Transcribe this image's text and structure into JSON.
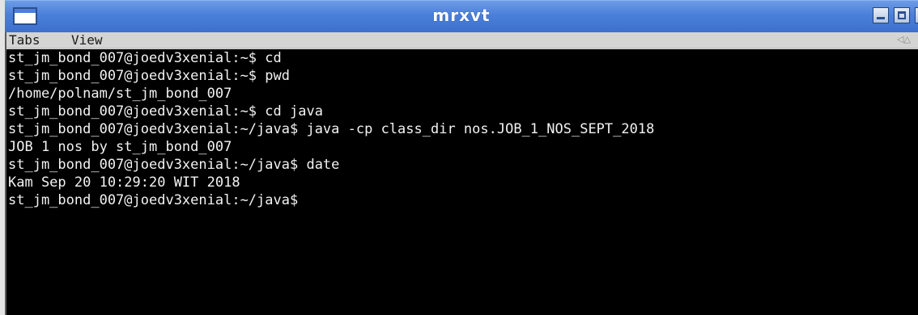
{
  "window": {
    "title": "mrxvt",
    "accent": "#4a7fda",
    "icons": [
      "system-menu-icon",
      "minimize-icon",
      "maximize-icon"
    ]
  },
  "menubar": {
    "items": [
      {
        "label": "Tabs"
      },
      {
        "label": "View"
      }
    ],
    "scroll_arrows": "◁△"
  },
  "terminal": {
    "background": "#000000",
    "foreground": "#f2f2f2",
    "lines": [
      "st_jm_bond_007@joedv3xenial:~$ cd",
      "st_jm_bond_007@joedv3xenial:~$ pwd",
      "/home/polnam/st_jm_bond_007",
      "st_jm_bond_007@joedv3xenial:~$ cd java",
      "st_jm_bond_007@joedv3xenial:~/java$ java -cp class_dir nos.JOB_1_NOS_SEPT_2018",
      "JOB 1 nos by st_jm_bond_007",
      "st_jm_bond_007@joedv3xenial:~/java$ date",
      "Kam Sep 20 10:29:20 WIT 2018",
      "st_jm_bond_007@joedv3xenial:~/java$"
    ]
  }
}
